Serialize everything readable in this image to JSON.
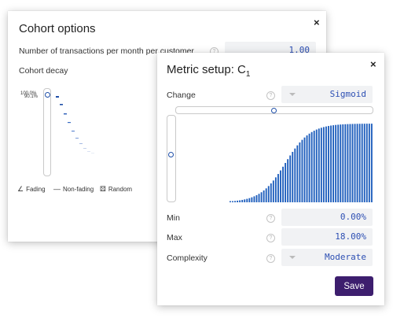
{
  "cohort_options": {
    "title": "Cohort options",
    "close_icon": "×",
    "transactions_label": "Number of transactions per month per customer",
    "transactions_value": "1.00",
    "cohort_decay_label": "Cohort decay",
    "tick_top": "100.0%",
    "tick_second": "90.1%",
    "legend": {
      "fading": "Fading",
      "non_fading": "Non-fading",
      "random": "Random"
    },
    "decay_slider_level": 1.0
  },
  "metric_setup": {
    "title": "Metric setup: C",
    "title_subscript": "1",
    "close_icon": "×",
    "change_label": "Change",
    "change_value": "Sigmoid",
    "min_label": "Min",
    "min_value": "0.00%",
    "max_label": "Max",
    "max_value": "18.00%",
    "complexity_label": "Complexity",
    "complexity_value": "Moderate",
    "save_label": "Save",
    "horizontal_slider_level": 0.5,
    "vertical_slider_level": 0.55
  },
  "colors": {
    "bars": "#1f5fbd",
    "save_button": "#3d1e6e",
    "field_text": "#2d4fb3"
  }
}
